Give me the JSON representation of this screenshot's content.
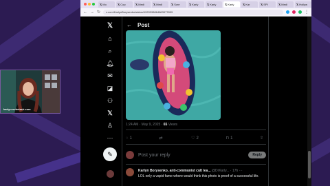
{
  "browser": {
    "tabs": [
      {
        "label": "Mo",
        "active": false
      },
      {
        "label": "Cop",
        "active": false
      },
      {
        "label": "Medi",
        "active": false
      },
      {
        "label": "Medi",
        "active": false
      },
      {
        "label": "Scre",
        "active": false
      },
      {
        "label": "Karly",
        "active": false
      },
      {
        "label": "Karly",
        "active": false
      },
      {
        "label": "Karly",
        "active": true
      },
      {
        "label": "Kar",
        "active": false
      },
      {
        "label": "SPI",
        "active": false
      },
      {
        "label": "Medi",
        "active": false
      },
      {
        "label": "Hollyw",
        "active": false
      }
    ],
    "url": "x.com/KarlynBorysenko/status/1920398864863977899"
  },
  "x_nav": {
    "items": [
      "x-logo-icon",
      "home-icon",
      "search-icon",
      "notifications-icon",
      "messages-icon",
      "grok-icon",
      "communities-icon",
      "premium-icon",
      "profile-icon",
      "more-icon"
    ],
    "compose_icon": "feather-icon"
  },
  "post": {
    "header_title": "Post",
    "timestamp": "1:24 AM · May 9, 2025 ·",
    "views_count": "65",
    "views_label": "Views",
    "actions": {
      "replies": "1",
      "retweets": "",
      "likes": "2",
      "bookmarks": "1"
    },
    "reply_placeholder": "Post your reply",
    "reply_button": "Reply"
  },
  "comment": {
    "author": "Karlyn Borysenko, anti-communist cult lea...",
    "handle_time": "@DrKarly... · 17h",
    "more": "···",
    "text": "LOL only a vapid fame whore would think this photo is proof of a successful life."
  },
  "webcam": {
    "label": "karlyn.substack.com"
  },
  "colors": {
    "background": "#2c1b52",
    "x_black": "#000000",
    "x_text": "#e7e9ea",
    "x_muted": "#71767b"
  }
}
